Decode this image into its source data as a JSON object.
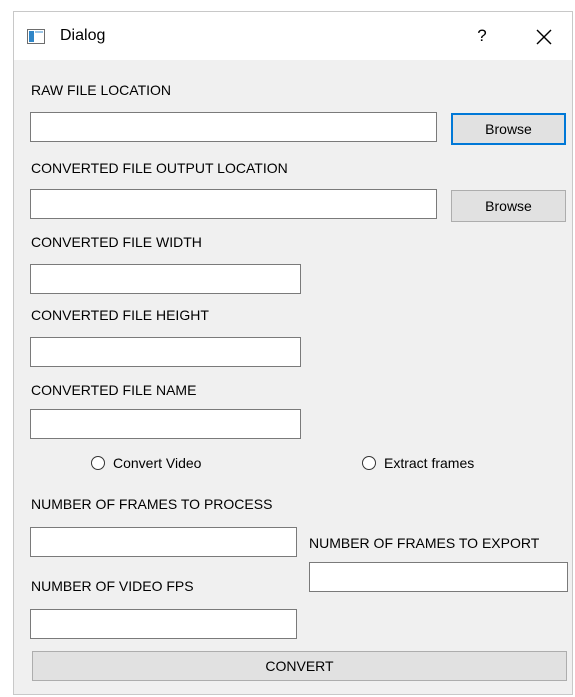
{
  "window": {
    "title": "Dialog",
    "help_label": "?"
  },
  "raw_file": {
    "label": "RAW FILE LOCATION",
    "value": "",
    "browse_label": "Browse"
  },
  "output_file": {
    "label": "CONVERTED FILE OUTPUT LOCATION",
    "value": "",
    "browse_label": "Browse"
  },
  "width": {
    "label": "CONVERTED FILE WIDTH",
    "value": ""
  },
  "height": {
    "label": "CONVERTED FILE HEIGHT",
    "value": ""
  },
  "name": {
    "label": "CONVERTED FILE NAME",
    "value": ""
  },
  "mode": {
    "options": [
      "Convert Video",
      "Extract frames"
    ],
    "selected": null
  },
  "frames_process": {
    "label": "NUMBER OF FRAMES TO PROCESS",
    "value": ""
  },
  "frames_export": {
    "label": "NUMBER OF FRAMES TO EXPORT",
    "value": ""
  },
  "video_fps": {
    "label": "NUMBER OF VIDEO FPS",
    "value": ""
  },
  "convert_label": "CONVERT",
  "colors": {
    "dialog_bg": "#f0f0f0",
    "focus_border": "#0078d7",
    "button_bg": "#e1e1e1"
  },
  "icons": {
    "app": "window-app-icon",
    "close": "close-icon"
  }
}
